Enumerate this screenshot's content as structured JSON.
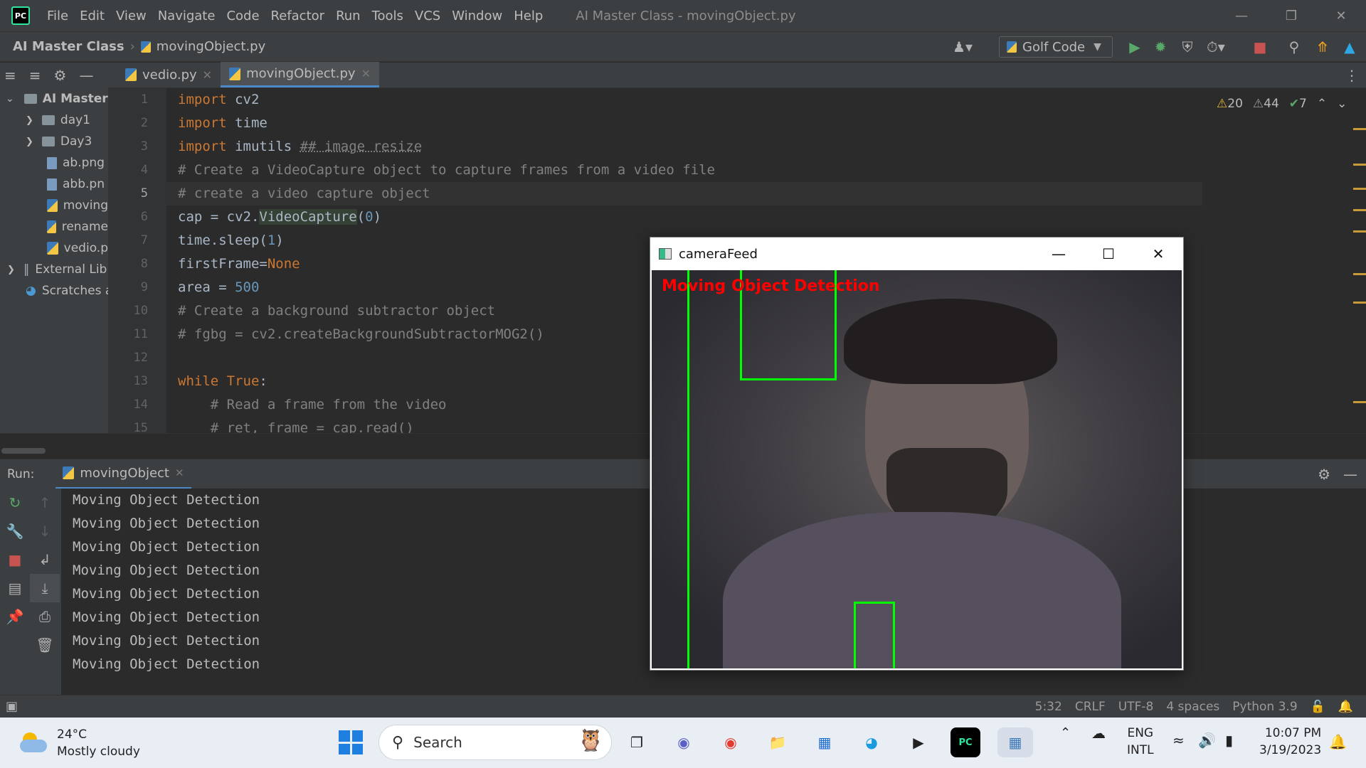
{
  "window": {
    "title": "AI Master Class - movingObject.py"
  },
  "menu": [
    "File",
    "Edit",
    "View",
    "Navigate",
    "Code",
    "Refactor",
    "Run",
    "Tools",
    "VCS",
    "Window",
    "Help"
  ],
  "breadcrumb": {
    "project": "AI Master Class",
    "file": "movingObject.py"
  },
  "run_config": "Golf Code",
  "tabs": [
    {
      "label": "vedio.py"
    },
    {
      "label": "movingObject.py"
    }
  ],
  "project_tree": [
    {
      "label": "AI Master",
      "kind": "root"
    },
    {
      "label": "day1",
      "kind": "folder"
    },
    {
      "label": "Day3",
      "kind": "folder"
    },
    {
      "label": "ab.png",
      "kind": "image"
    },
    {
      "label": "abb.pn",
      "kind": "image"
    },
    {
      "label": "moving",
      "kind": "py"
    },
    {
      "label": "rename",
      "kind": "py"
    },
    {
      "label": "vedio.p",
      "kind": "py"
    },
    {
      "label": "External Lib",
      "kind": "lib"
    },
    {
      "label": "Scratches a",
      "kind": "scratch"
    }
  ],
  "inspections": {
    "warnings": "20",
    "weak_warnings": "44",
    "ok": "7"
  },
  "line_numbers": [
    "1",
    "2",
    "3",
    "4",
    "5",
    "6",
    "7",
    "8",
    "9",
    "10",
    "11",
    "12",
    "13",
    "14",
    "15"
  ],
  "code": {
    "l1a": "import",
    "l1b": " cv2",
    "l2a": "import",
    "l2b": " time",
    "l3a": "import",
    "l3b": " imutils ",
    "l3c": "## image resize",
    "l4": "# Create a VideoCapture object to capture frames from a video file",
    "l5": "# create a video capture object",
    "l6a": "cap = cv2.",
    "l6b": "VideoCapture",
    "l6c": "(",
    "l6d": "0",
    "l6e": ")",
    "l7a": "time.sleep(",
    "l7b": "1",
    "l7c": ")",
    "l8a": "firstFrame=",
    "l8b": "None",
    "l9a": "area = ",
    "l9b": "500",
    "l10": "# Create a background subtractor object",
    "l11": "# fgbg = cv2.createBackgroundSubtractorMOG2()",
    "l12": "",
    "l13a": "while",
    "l13b": " True",
    ":": ":",
    "l14": "    # Read a frame from the video",
    "l15": "    # ret, frame = cap.read()"
  },
  "run_panel": {
    "label": "Run:",
    "tab": "movingObject"
  },
  "console_lines": [
    "Moving Object Detection",
    "Moving Object Detection",
    "Moving Object Detection",
    "Moving Object Detection",
    "Moving Object Detection",
    "Moving Object Detection",
    "Moving Object Detection",
    "Moving Object Detection"
  ],
  "status": {
    "position": "5:32",
    "line_sep": "CRLF",
    "encoding": "UTF-8",
    "indent": "4 spaces",
    "interpreter": "Python 3.9"
  },
  "camera_window": {
    "title": "cameraFeed",
    "overlay_text": "Moving Object Detection"
  },
  "taskbar": {
    "weather_temp": "24°C",
    "weather_desc": "Mostly cloudy",
    "search_placeholder": "Search",
    "lang": "ENG",
    "layout": "INTL",
    "time": "10:07 PM",
    "date": "3/19/2023"
  }
}
